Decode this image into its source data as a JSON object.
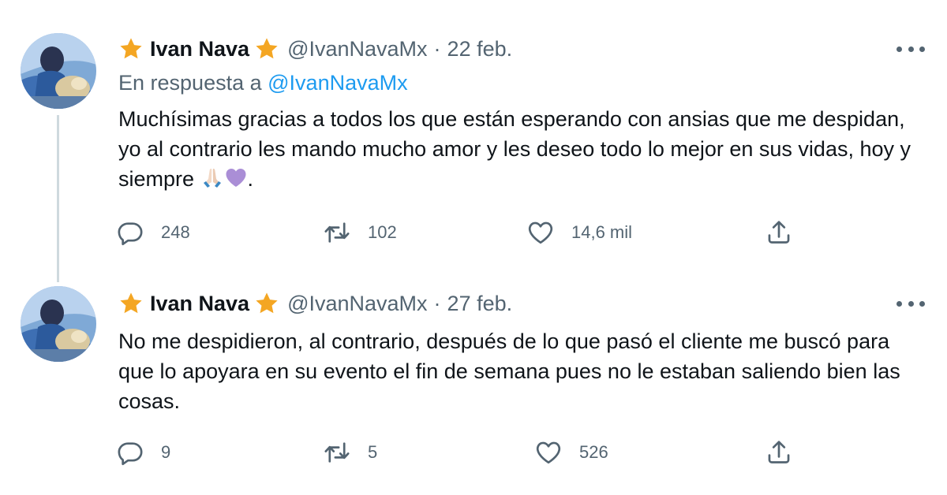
{
  "tweets": [
    {
      "author": {
        "name": "Ivan Nava",
        "handle": "@IvanNavaMx",
        "badge_icon": "star-icon",
        "badge_color": "#f4a623"
      },
      "separator": "·",
      "date": "22 feb.",
      "reply_to": {
        "prefix": "En respuesta a",
        "mention": "@IvanNavaMx"
      },
      "text": "Muchísimas gracias a todos los que están esperando con ansias que me despidan, yo al contrario les mando mucho amor y les deseo todo lo mejor en sus vidas, hoy y siempre",
      "text_suffix": ".",
      "emojis": [
        "folded-hands-icon",
        "purple-heart-icon"
      ],
      "stats": {
        "replies": "248",
        "retweets": "102",
        "likes": "14,6 mil"
      }
    },
    {
      "author": {
        "name": "Ivan Nava",
        "handle": "@IvanNavaMx",
        "badge_icon": "star-icon",
        "badge_color": "#f4a623"
      },
      "separator": "·",
      "date": "27 feb.",
      "text": "No me despidieron, al contrario, después de lo que pasó el cliente me buscó para que lo apoyara en su evento el fin de semana pues no le estaban saliendo bien las cosas.",
      "stats": {
        "replies": "9",
        "retweets": "5",
        "likes": "526"
      }
    }
  ],
  "colors": {
    "text": "#0f1419",
    "secondary": "#536471",
    "link": "#1d9bf0",
    "thread_line": "#cfd9de"
  }
}
